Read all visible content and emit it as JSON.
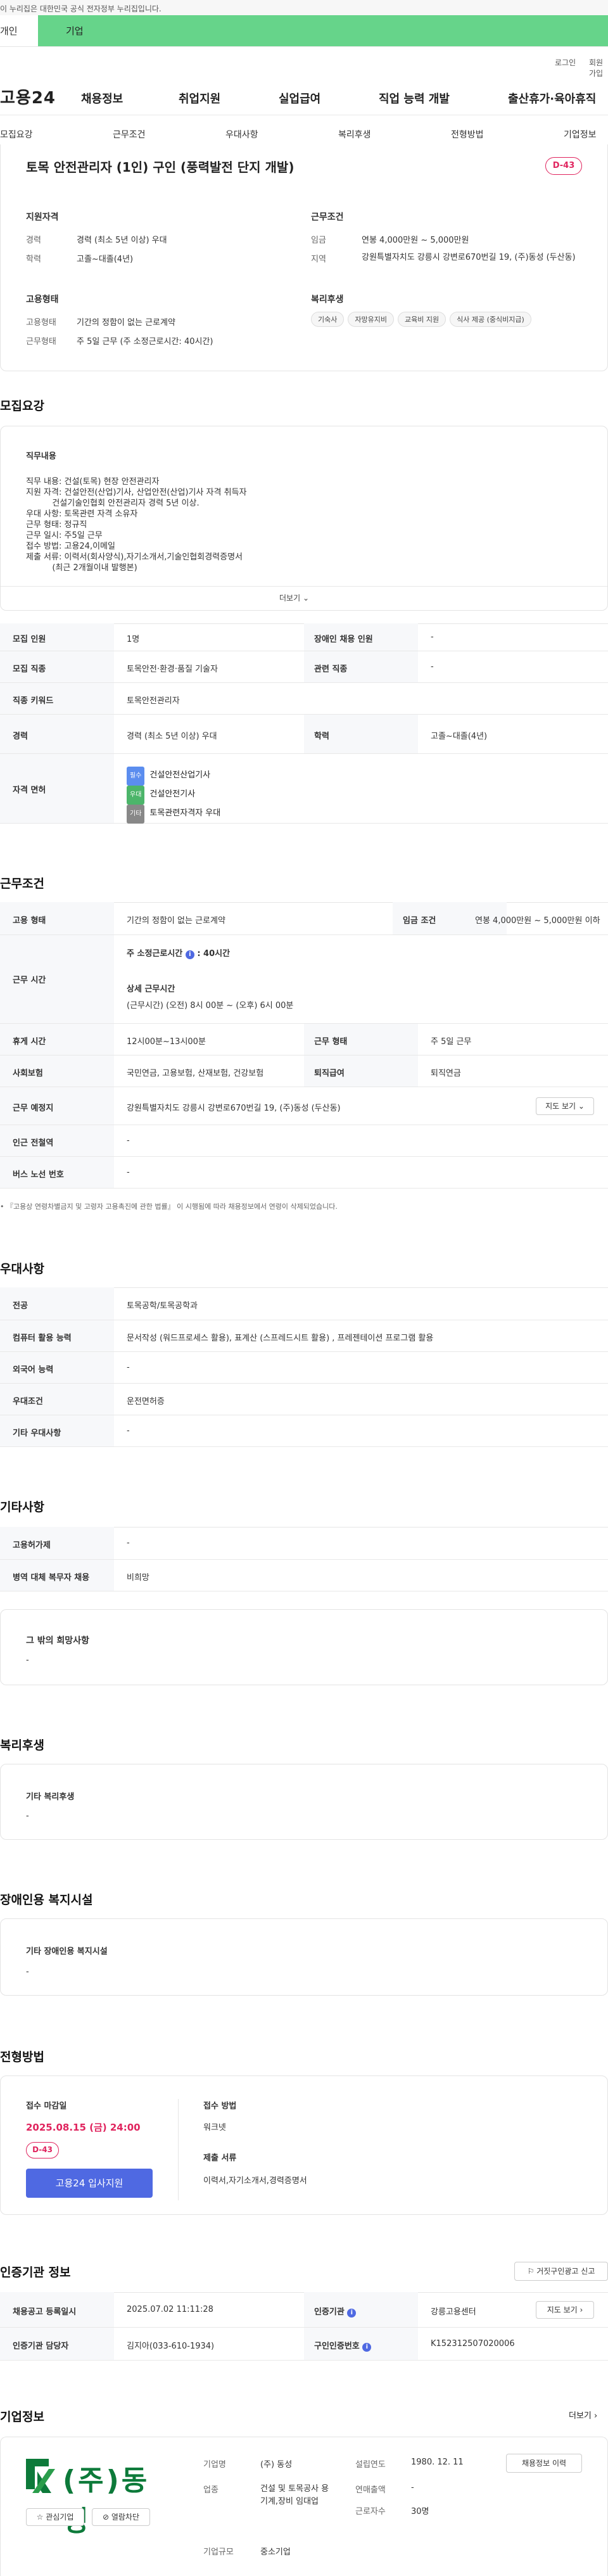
{
  "top": {
    "notice": "이 누리집은 대한민국 공식 전자정부 누리집입니다.",
    "tab_person": "개인",
    "tab_company": "기업",
    "login": "로그인",
    "join": "회원가입"
  },
  "gnb": {
    "logo": "고용24",
    "menu": [
      "채용정보",
      "취업지원",
      "실업급여",
      "직업 능력 개발",
      "출산휴가·육아휴직"
    ]
  },
  "subnav": [
    "모집요강",
    "근무조건",
    "우대사항",
    "복리후생",
    "전형방법",
    "기업정보"
  ],
  "summary": {
    "title": "토목 안전관리자 (1인) 구인 (풍력발전 단지 개발)",
    "dday": "D-43",
    "qual_title": "지원자격",
    "career_label": "경력",
    "career": "경력 (최소 5년 이상) 우대",
    "edu_label": "학력",
    "edu": "고졸~대졸(4년)",
    "cond_title": "근무조건",
    "wage_label": "임금",
    "wage": "연봉 4,000만원 ~ 5,000만원",
    "region_label": "지역",
    "region": "강원특별자치도 강릉시 강변로670번길 19, (주)동성 (두산동)",
    "emp_title": "고용형태",
    "emptype_label": "고용형태",
    "emptype": "기간의 정함이 없는 근로계약",
    "worktype_label": "근무형태",
    "worktype": "주 5일 근무 (주 소정근로시간: 40시간)",
    "welfare_title": "복리후생",
    "welfare": [
      "기숙사",
      "자망유지비",
      "교육비 지원",
      "식사 제공 (중식비지급)"
    ]
  },
  "recruit": {
    "heading": "모집요강",
    "content_title": "직무내용",
    "lines": [
      "직무 내용: 건설(토목) 현장 안전관리자",
      "지원 자격: 건설안전(산업)기사, 산업안전(산업)기사 자격 취득자",
      "          건설기술인협회 안전관리자 경력 5년 이상.",
      "우대 사항: 토목관련 자격 소유자",
      "근무 형태: 정규직",
      "근무 일시: 주5일 근무",
      "접수 방법: 고용24,이메일",
      "제출 서류: 이력서(회사양식),자기소개서,기술인협회경력증명서",
      "          (최근 2개월이내 발행본)"
    ],
    "more": "더보기",
    "headcount_label": "모집 인원",
    "headcount": "1명",
    "disabled_label": "장애인 채용 인원",
    "disabled": "-",
    "job_label": "모집 직종",
    "job": "토목안전·환경·품질 기술자",
    "related_label": "관련 직종",
    "related": "-",
    "keyword_label": "직종 키워드",
    "keyword": "토목안전관리자",
    "career_label": "경력",
    "career": "경력 (최소 5년 이상) 우대",
    "edu_label": "학력",
    "edu": "고졸~대졸(4년)",
    "license_label": "자격 면허",
    "licenses": [
      {
        "tag": "필수",
        "name": "건설안전산업기사",
        "color": "#5b8def"
      },
      {
        "tag": "우대",
        "name": "건설안전기사",
        "color": "#4cb56a"
      },
      {
        "tag": "기타",
        "name": "토목관련자격자 우대",
        "color": "#888888"
      }
    ]
  },
  "work": {
    "heading": "근무조건",
    "emp_label": "고용 형태",
    "emp": "기간의 정함이 없는 근로계약",
    "wage_label": "임금 조건",
    "wage": "연봉 4,000만원 ~ 5,000만원 이하",
    "time_label": "근무 시간",
    "weekly": "주 소정근로시간",
    "weekly_val": ": 40시간",
    "detail_title": "상세 근무시간",
    "detail": "(근무시간) (오전) 8시 00분 ~ (오후) 6시 00분",
    "rest_label": "휴게 시간",
    "rest": "12시00분~13시00분",
    "form_label": "근무 형태",
    "form": "주 5일 근무",
    "ins_label": "사회보험",
    "ins": "국민연금, 고용보험, 산재보험, 건강보험",
    "sev_label": "퇴직급여",
    "sev": "퇴직연금",
    "place_label": "근무 예정지",
    "place": "강원특별자치도 강릉시 강변로670번길 19, (주)동성 (두산동)",
    "map_btn": "지도 보기",
    "subway_label": "인근 전철역",
    "subway": "-",
    "bus_label": "버스 노선 번호",
    "bus": "-",
    "note": "『고용상 연령차별금지 및 고령자 고용촉진에 관한 법률』 이 시행됨에 따라 채용정보에서 연령이 삭제되었습니다."
  },
  "pref": {
    "heading": "우대사항",
    "major_label": "전공",
    "major": "토목공학/토목공학과",
    "pc_label": "컴퓨터 활용 능력",
    "pc": "문서작성 (워드프로세스 활용), 표계산 (스프레드시트 활용) , 프레젠테이션 프로그램 활용",
    "lang_label": "외국어 능력",
    "lang": "-",
    "cond_label": "우대조건",
    "cond": "운전면허증",
    "etc_label": "기타 우대사항",
    "etc": "-"
  },
  "etc": {
    "heading": "기타사항",
    "ins_label": "고용허가제",
    "ins": "-",
    "mil_label": "병역 대체 복무자 채용",
    "mil": "비희망",
    "other_title": "그 밖의 희망사항",
    "other": "-"
  },
  "welfare": {
    "heading": "복리후생",
    "title": "기타 복리후생",
    "val": "-"
  },
  "disab": {
    "heading": "장애인용 복지시설",
    "title": "기타 장애인용 복지시설",
    "val": "-"
  },
  "apply": {
    "heading": "전형방법",
    "deadline_label": "접수 마감일",
    "deadline": "2025.08.15 (금) 24:00",
    "dday": "D-43",
    "apply_btn": "고용24 입사지원",
    "method_label": "접수 방법",
    "method": "워크넷",
    "docs_label": "제출 서류",
    "docs": "이력서,자기소개서,경력증명서"
  },
  "cert": {
    "heading": "인증기관 정보",
    "report_btn": "거짓구인광고 신고",
    "reg_label": "채용공고 등록일시",
    "reg": "2025.07.02 11:11:28",
    "org_label": "인증기관",
    "org": "강릉고용센터",
    "map_btn": "지도 보기",
    "mgr_label": "인증기관 담당자",
    "mgr": "김지아(033-610-1934)",
    "no_label": "구인인증번호",
    "no": "K152312507020006"
  },
  "company": {
    "heading": "기업정보",
    "more": "더보기",
    "logo": "(주)동성",
    "like": "관심기업",
    "block": "열람차단",
    "name_label": "기업명",
    "name": "(주) 동성",
    "est_label": "설립연도",
    "est": "1980. 12. 11",
    "biz_label": "업종",
    "biz": "건설 및 토목공사 용 기계,장비 임대업",
    "sales_label": "연매출액",
    "sales": "-",
    "emp_label": "근로자수",
    "emp": "30명",
    "size_label": "기업규모",
    "size": "중소기업",
    "jobs_btn": "채용정보 이력"
  }
}
